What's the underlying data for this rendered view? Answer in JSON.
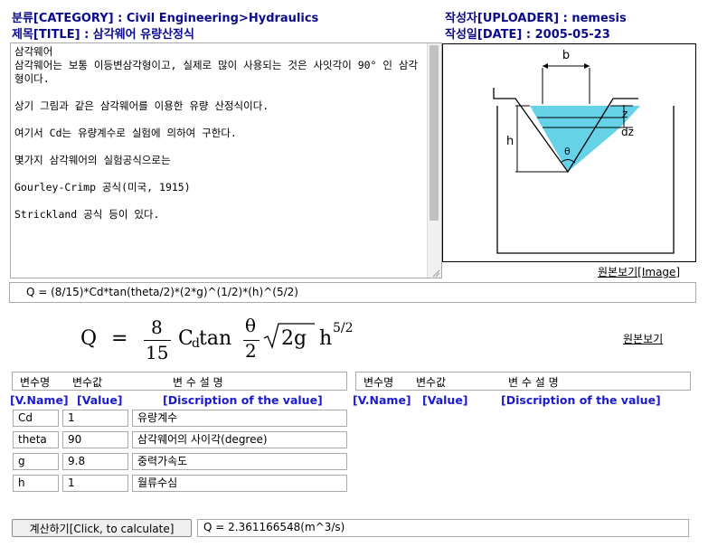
{
  "header": {
    "category": "분류[CATEGORY] : Civil Engineering>Hydraulics",
    "title": "제목[TITLE] : 삼각웨어 유량산정식",
    "uploader": "작성자[UPLOADER] : nemesis",
    "date": "작성일[DATE] : 2005-05-23"
  },
  "description": "삼각웨어\n삼각웨어는 보통 이등변삼각형이고, 실제로 많이 사용되는 것은 사잇각이 90° 인 삼각형이다.\n\n상기 그림과 같은 삼각웨어를 이용한 유량 산정식이다.\n\n여기서 Cd는 유량계수로 실험에 의하여 구한다.\n\n몇가지 삼각웨어의 실험공식으로는\n\nGourley-Crimp 공식(미국, 1915)\n\nStrickland 공식 등이 있다.",
  "diagram": {
    "label_b": "b",
    "label_z": "z",
    "label_dz": "dz",
    "label_h": "h",
    "label_theta": "θ"
  },
  "view_image_link": "원본보기[Image]",
  "formula_text": "Q = (8/15)*Cd*tan(theta/2)*(2*g)^(1/2)*(h)^(5/2)",
  "formula_render": {
    "q": "Q",
    "eq": "=",
    "num": "8",
    "den": "15",
    "cd": "C",
    "cd_sub": "d",
    "tan": "tan",
    "th": "θ",
    "two": "2",
    "rad": "2g",
    "h": "h",
    "exp": "5/2"
  },
  "view_original_link": "원본보기",
  "var_headers": {
    "name": "변수명",
    "value": "변수값",
    "desc": "변 수 설 명"
  },
  "var_headers_en": {
    "name": "[V.Name]",
    "value": "[Value]",
    "desc": "[Discription of the value]"
  },
  "variables": [
    {
      "name": "Cd",
      "value": "1",
      "desc": "유량계수"
    },
    {
      "name": "theta",
      "value": "90",
      "desc": "삼각웨어의 사이각(degree)"
    },
    {
      "name": "g",
      "value": "9.8",
      "desc": "중력가속도"
    },
    {
      "name": "h",
      "value": "1",
      "desc": "월류수심"
    }
  ],
  "calc_button": "계산하기[Click, to calculate]",
  "result": "Q =  2.361166548(m^3/s)"
}
